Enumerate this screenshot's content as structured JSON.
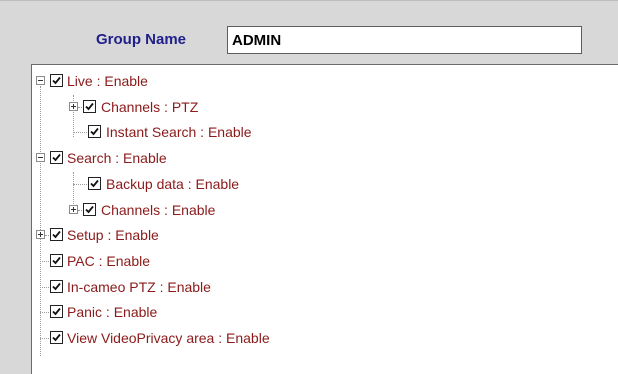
{
  "group": {
    "label": "Group Name",
    "value": "ADMIN"
  },
  "tree": {
    "nodes": [
      {
        "label": "Live : Enable",
        "checked": true,
        "expander": "minus"
      },
      {
        "label": "Channels : PTZ",
        "checked": true,
        "expander": "plus"
      },
      {
        "label": "Instant Search : Enable",
        "checked": true,
        "expander": "none"
      },
      {
        "label": "Search : Enable",
        "checked": true,
        "expander": "minus"
      },
      {
        "label": "Backup data : Enable",
        "checked": true,
        "expander": "none"
      },
      {
        "label": "Channels : Enable",
        "checked": true,
        "expander": "plus"
      },
      {
        "label": "Setup : Enable",
        "checked": true,
        "expander": "plus"
      },
      {
        "label": "PAC : Enable",
        "checked": true,
        "expander": "none"
      },
      {
        "label": "In-cameo PTZ : Enable",
        "checked": true,
        "expander": "none"
      },
      {
        "label": "Panic : Enable",
        "checked": true,
        "expander": "none"
      },
      {
        "label": "View VideoPrivacy area : Enable",
        "checked": true,
        "expander": "none"
      }
    ]
  },
  "colors": {
    "label_text": "#8b1a1a",
    "group_label": "#1f1f8a",
    "background": "#d8d8d8"
  }
}
